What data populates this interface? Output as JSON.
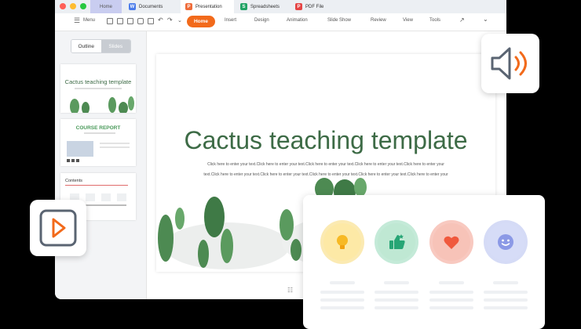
{
  "tabs": {
    "home": "Home",
    "documents": "Documents",
    "presentation": "Presentation",
    "spreadsheets": "Spreadsheets",
    "pdf": "PDF File"
  },
  "toolbar": {
    "menu": "Menu",
    "home": "Home",
    "insert": "Insert",
    "design": "Design",
    "animation": "Animation",
    "slideshow": "Slide Show",
    "review": "Review",
    "view": "View",
    "tools": "Tools"
  },
  "panel": {
    "outline": "Outline",
    "slides": "Slides"
  },
  "thumbnails": {
    "t1_title": "Cactus teaching template",
    "t2_title": "COURSE REPORT",
    "t3_title": "Contents"
  },
  "slide": {
    "title": "Cactus teaching template",
    "body1": "Click here to enter your text.Click here to enter your text.Click here to enter your text.Click here to enter your text.Click here to enter your",
    "body2": "text.Click here to enter your text.Click here to enter your text.Click here to enter your text.Click here to enter your text.Click here to enter your"
  },
  "colors": {
    "accent": "#f26a1b",
    "cactus_green": "#3d6b46",
    "home_tab": "#c9cdf0"
  },
  "icons": {
    "audio": "speaker-icon",
    "video": "play-icon",
    "f1": "lightbulb-icon",
    "f2": "thumbs-up-icon",
    "f3": "heart-icon",
    "f4": "smiley-icon"
  }
}
